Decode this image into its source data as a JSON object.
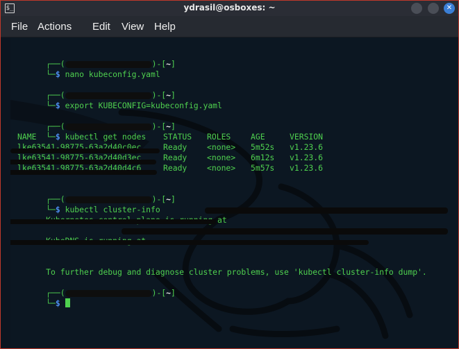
{
  "window": {
    "title": "ydrasil@osboxes: ~",
    "app_icon_glyph": "$_",
    "buttons": {
      "minimize": "",
      "maximize": "",
      "close": "✕"
    }
  },
  "menu": [
    "File",
    "Actions",
    "Edit",
    "View",
    "Help"
  ],
  "prompt": {
    "box_top": "┌──(",
    "box_mid": ")-[",
    "path": "~",
    "box_end": "]",
    "box_bottom": "└─",
    "dollar": "$"
  },
  "commands": [
    "nano kubeconfig.yaml",
    "export KUBECONFIG=kubeconfig.yaml",
    "kubectl get nodes",
    "kubectl cluster-info"
  ],
  "nodes_table": {
    "headers": [
      "NAME",
      "STATUS",
      "ROLES",
      "AGE",
      "VERSION"
    ],
    "rows": [
      {
        "name": "lke63541-98775-63a2d40c0ec",
        "status": "Ready",
        "roles": "<none>",
        "age": "5m52s",
        "version": "v1.23.6"
      },
      {
        "name": "lke63541-98775-63a2d40d3ec",
        "status": "Ready",
        "roles": "<none>",
        "age": "6m12s",
        "version": "v1.23.6"
      },
      {
        "name": "lke63541-98775-63a2d40d4c6",
        "status": "Ready",
        "roles": "<none>",
        "age": "5m57s",
        "version": "v1.23.6"
      }
    ]
  },
  "cluster_info": {
    "control_plane_prefix": "Kubernetes control plane is running at",
    "kubedns_prefix": "KubeDNS is running at",
    "hint": "To further debug and diagnose cluster problems, use 'kubectl cluster-info dump'."
  },
  "colors": {
    "terminal_bg": "#0c1722",
    "green": "#4fd14f",
    "blue": "#4d8ff0",
    "titlebar": "#2a2d35",
    "close_button": "#3b7fd6"
  }
}
